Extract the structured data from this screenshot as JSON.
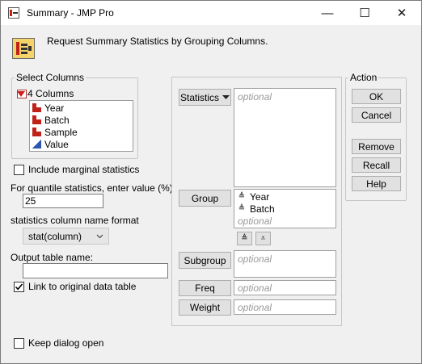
{
  "window": {
    "title": "Summary - JMP Pro",
    "controls": {
      "minimize": "—",
      "maximize": "☐",
      "close": "✕"
    }
  },
  "header": {
    "text": "Request Summary Statistics by Grouping Columns."
  },
  "select_columns": {
    "legend": "Select Columns",
    "count_label": "4 Columns",
    "items": [
      {
        "name": "Year",
        "type": "nominal"
      },
      {
        "name": "Batch",
        "type": "nominal"
      },
      {
        "name": "Sample",
        "type": "nominal"
      },
      {
        "name": "Value",
        "type": "continuous"
      }
    ]
  },
  "options": {
    "include_marginal_label": "Include marginal statistics",
    "include_marginal_checked": false,
    "quantile_label": "For quantile statistics, enter value (%)",
    "quantile_value": "25",
    "name_format_label": "statistics column name format",
    "name_format_value": "stat(column)",
    "output_table_label": "Output table name:",
    "output_table_value": "",
    "link_label": "Link to original data table",
    "link_checked": true,
    "keep_open_label": "Keep dialog open",
    "keep_open_checked": false
  },
  "roles": {
    "optional_text": "optional",
    "statistics_label": "Statistics",
    "group_label": "Group",
    "group_items": [
      "Year",
      "Batch"
    ],
    "subgroup_label": "Subgroup",
    "freq_label": "Freq",
    "weight_label": "Weight"
  },
  "action": {
    "legend": "Action",
    "ok": "OK",
    "cancel": "Cancel",
    "remove": "Remove",
    "recall": "Recall",
    "help": "Help"
  },
  "icons": {
    "ordinal_glyph": "≜",
    "move_up": "≜",
    "move_down": "⩡"
  }
}
